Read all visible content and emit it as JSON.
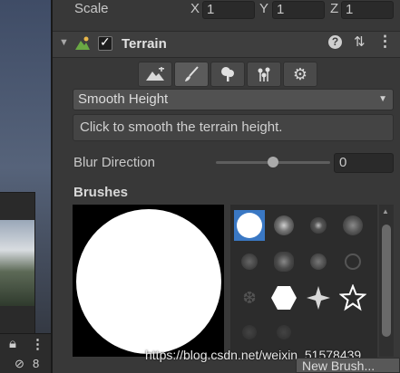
{
  "transform": {
    "scale_label": "Scale",
    "x_axis": "X",
    "x_value": "1",
    "y_axis": "Y",
    "y_value": "1",
    "z_axis": "Z",
    "z_value": "1"
  },
  "component": {
    "title": "Terrain",
    "enabled": true,
    "icons": [
      "terrain-icon",
      "help-icon",
      "preset-icon",
      "context-menu-icon"
    ]
  },
  "tools": [
    {
      "name": "raise-lower-terrain",
      "icon": "mountain-plus-icon",
      "selected": false
    },
    {
      "name": "paint-terrain",
      "icon": "brush-icon",
      "selected": true
    },
    {
      "name": "paint-trees",
      "icon": "tree-icon",
      "selected": false
    },
    {
      "name": "paint-details",
      "icon": "flowers-icon",
      "selected": false
    },
    {
      "name": "terrain-settings",
      "icon": "gear-icon",
      "selected": false
    }
  ],
  "paint_mode": {
    "selected": "Smooth Height",
    "description": "Click to smooth the terrain height."
  },
  "blur": {
    "label": "Blur Direction",
    "value": "0",
    "slider_fraction": 0.5
  },
  "brushes": {
    "label": "Brushes",
    "selected_index": 0,
    "new_brush_label": "New Brush..."
  },
  "scene": {
    "bottom_left_icon": "lock-icon",
    "bottom_menu_icon": "menu-icon",
    "visibility_count": "8"
  },
  "watermark": "https://blog.csdn.net/weixin_51578439",
  "colors": {
    "panel": "#383838",
    "field": "#2a2a2a",
    "selected_brush": "#3a78c4"
  }
}
